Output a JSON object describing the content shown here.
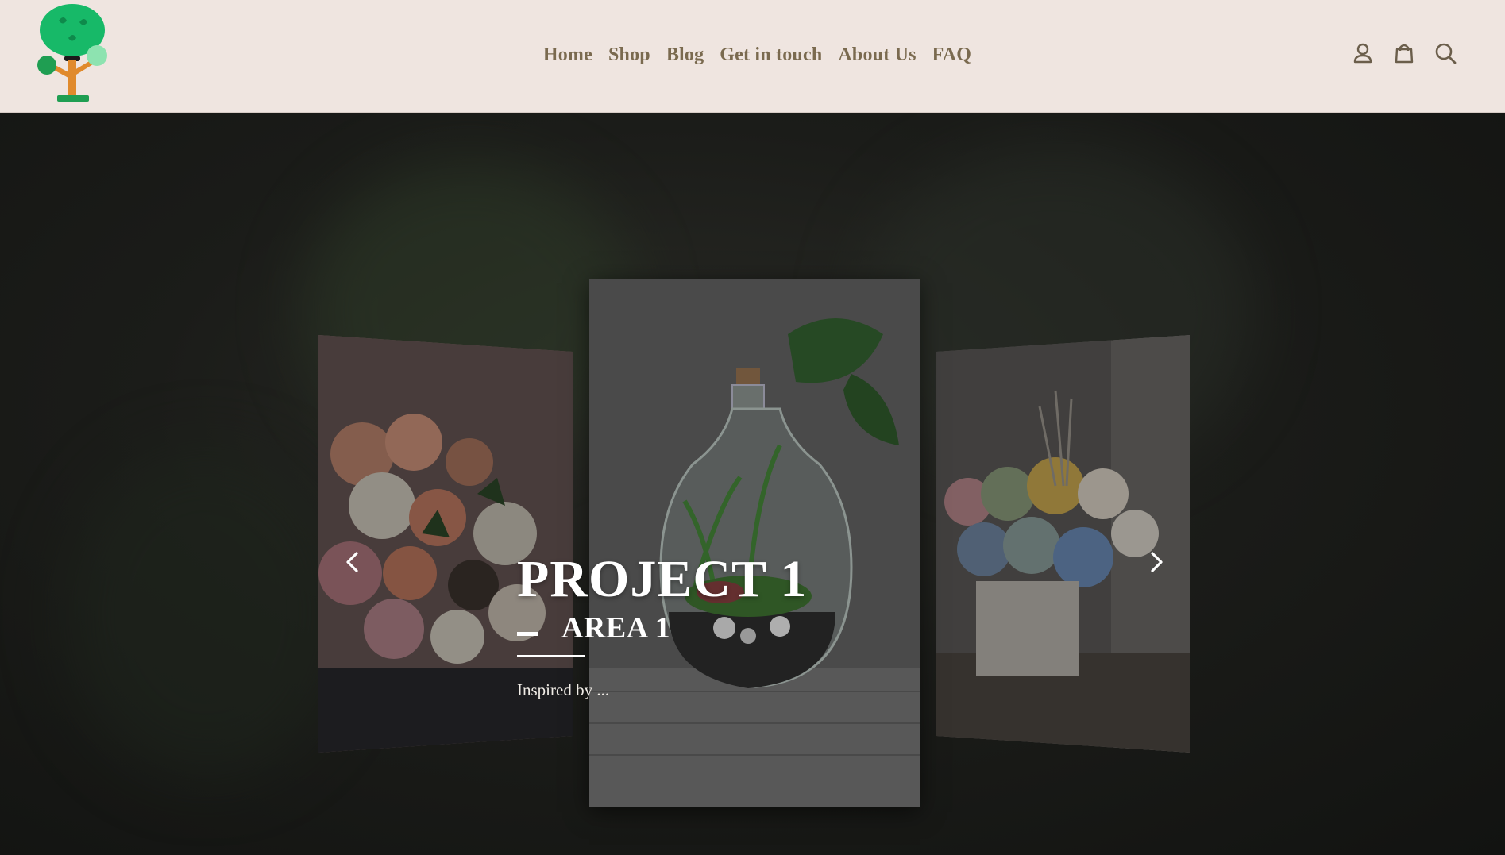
{
  "nav": {
    "items": [
      {
        "label": "Home"
      },
      {
        "label": "Shop"
      },
      {
        "label": "Blog"
      },
      {
        "label": "Get in touch"
      },
      {
        "label": "About Us"
      },
      {
        "label": "FAQ"
      }
    ]
  },
  "header_icons": [
    "user-icon",
    "shopping-bag-icon",
    "search-icon"
  ],
  "colors": {
    "header_bg": "#efe5e0",
    "nav_text": "#7a6a4f",
    "logo_green": "#1fbf6e",
    "logo_trunk": "#e08a2c"
  },
  "slider": {
    "title": "PROJECT 1",
    "subtitle": "AREA 1",
    "description": "Inspired by ...",
    "prev_icon": "chevron-left-icon",
    "next_icon": "chevron-right-icon"
  }
}
